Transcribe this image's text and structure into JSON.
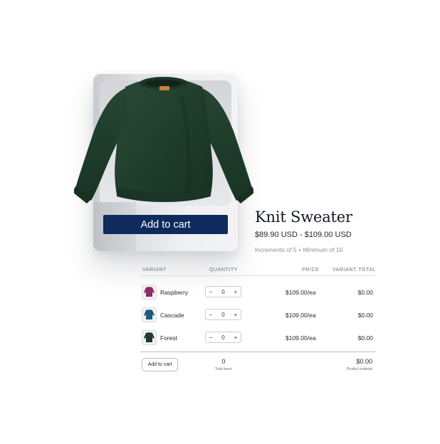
{
  "product_card": {
    "add_to_cart_label": "Add to cart",
    "image_alt": "Knit sweater"
  },
  "product": {
    "title": "Knit Sweater",
    "price_range": "$89.90 USD - $109.00 USD",
    "increments": "Increments of 5",
    "minimum": "Minimum of 10"
  },
  "table": {
    "headers": {
      "variant": "VARIANT",
      "quantity": "QUANTITY",
      "price": "PRICE",
      "variant_total": "VARIANT TOTAL"
    },
    "rows": [
      {
        "name": "Raspberry",
        "quantity": "0",
        "price": "$109.00/ea",
        "total": "$0.00",
        "color": "#8d2b63"
      },
      {
        "name": "Cascade",
        "quantity": "0",
        "price": "$109.00/ea",
        "total": "$0.00",
        "color": "#1d5a7a"
      },
      {
        "name": "Forest",
        "quantity": "0",
        "price": "$109.00/ea",
        "total": "$0.00",
        "color": "#1f3a2c"
      }
    ],
    "stepper": {
      "minus": "−",
      "plus": "+"
    }
  },
  "footer": {
    "add_to_cart_label": "Add to cart",
    "total_items_value": "0",
    "total_items_label": "Total items",
    "subtotal_value": "$0.00",
    "subtotal_label": "Product subtotal"
  },
  "colors": {
    "button_navy": "#0f2a5c",
    "sweater_green": "#23402f"
  }
}
